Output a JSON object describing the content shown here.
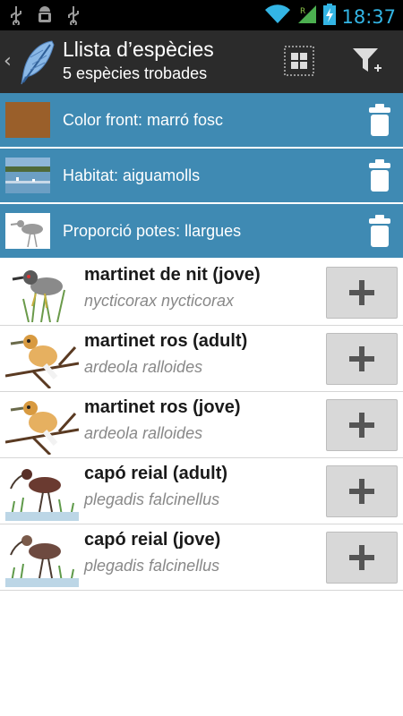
{
  "status_bar": {
    "time": "18:37",
    "icons": [
      "usb-icon",
      "android-debug-icon",
      "usb-icon",
      "wifi-icon",
      "signal-icon",
      "battery-charging-icon"
    ],
    "accent": "#33b5e5"
  },
  "action_bar": {
    "title": "Llista d’espècies",
    "subtitle": "5 espècies trobades",
    "icons": [
      "back-chevron-icon",
      "feather-logo-icon",
      "grid-view-icon",
      "add-filter-icon"
    ]
  },
  "filters": [
    {
      "label": "Color front: marró fosc",
      "thumb": "brown-swatch",
      "swatch_color": "#9a5f2a"
    },
    {
      "label": "Habitat: aiguamolls",
      "thumb": "wetland-photo"
    },
    {
      "label": "Proporció potes: llargues",
      "thumb": "long-legs-bird"
    }
  ],
  "species": [
    {
      "common": "martinet de nit (jove)",
      "latin": "nycticorax nycticorax",
      "illustration": "night-heron"
    },
    {
      "common": "martinet ros (adult)",
      "latin": "ardeola ralloides",
      "illustration": "squacco-heron"
    },
    {
      "common": "martinet ros (jove)",
      "latin": "ardeola ralloides",
      "illustration": "squacco-heron"
    },
    {
      "common": "capó reial (adult)",
      "latin": "plegadis falcinellus",
      "illustration": "glossy-ibis"
    },
    {
      "common": "capó reial (jove)",
      "latin": "plegadis falcinellus",
      "illustration": "glossy-ibis"
    }
  ],
  "colors": {
    "filter_bg": "#3f8ab3",
    "action_bar_bg": "#2b2b2b"
  }
}
